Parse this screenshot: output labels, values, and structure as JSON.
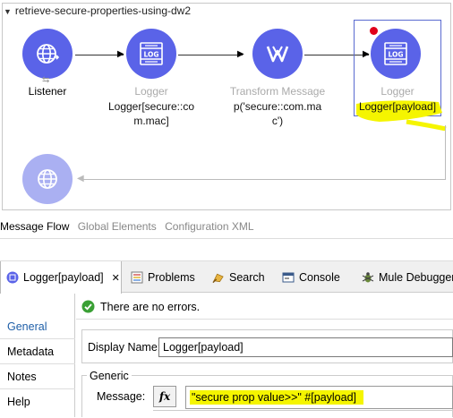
{
  "flow": {
    "name": "retrieve-secure-properties-using-dw2",
    "nodes": [
      {
        "type": "Listener",
        "detail": "",
        "icon": "globe-icon"
      },
      {
        "type": "Logger",
        "detail_line1": "Logger[secure::co",
        "detail_line2": "m.mac]",
        "icon": "log-icon"
      },
      {
        "type": "Transform Message",
        "detail_line1": "p('secure::com.ma",
        "detail_line2": "c')",
        "icon": "transform-icon"
      },
      {
        "type": "Logger",
        "detail": "Logger[payload]",
        "icon": "log-icon"
      }
    ],
    "response_icon": "globe-icon",
    "log_text": "LOG"
  },
  "editor_tabs": {
    "message_flow": "Message Flow",
    "global_elements": "Global Elements",
    "configuration_xml": "Configuration XML"
  },
  "views": {
    "tabs": [
      {
        "label": "Logger[payload]",
        "close": "✕",
        "icon": "logger-tab-icon"
      },
      {
        "label": "Problems",
        "icon": "problems-icon"
      },
      {
        "label": "Search",
        "icon": "search-icon"
      },
      {
        "label": "Console",
        "icon": "console-icon"
      },
      {
        "label": "Mule Debugger",
        "icon": "debugger-icon"
      }
    ]
  },
  "properties": {
    "nav": [
      "General",
      "Metadata",
      "Notes",
      "Help"
    ],
    "status": "There are no errors.",
    "display_name_label": "Display Name:",
    "display_name_value": "Logger[payload]",
    "group_title": "Generic",
    "message_label": "Message:",
    "fx_label": "fx",
    "message_value": "\"secure  prop value>>\" #[payload]"
  },
  "colors": {
    "node": "#5a63e8",
    "highlight": "#f5f500",
    "breakpoint": "#e0001a",
    "active_nav": "#1f5fa8"
  }
}
